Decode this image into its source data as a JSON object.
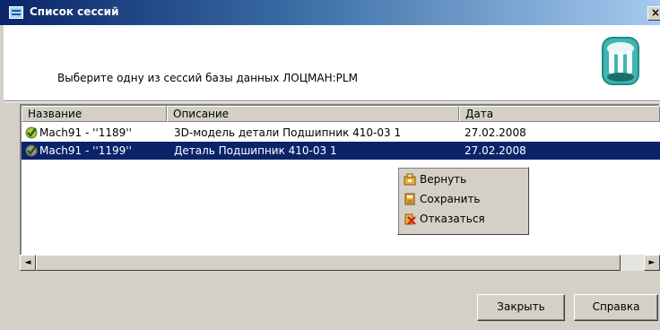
{
  "window": {
    "title": "Список сессий",
    "close_label": "×"
  },
  "header": {
    "message": "Выберите одну из сессий базы данных ЛОЦМАН:PLM",
    "icon": "database-icon"
  },
  "list": {
    "columns": [
      "Название",
      "Описание",
      "Дата"
    ],
    "rows": [
      {
        "name": "Mach91 - ''1189''",
        "description": "3D-модель детали Подшипник 410-03 1",
        "date": "27.02.2008",
        "icon": "checkmark-icon",
        "selected": false
      },
      {
        "name": "Mach91 - ''1199''",
        "description": "Деталь Подшипник 410-03 1",
        "date": "27.02.2008",
        "icon": "checkmark-icon",
        "selected": true
      }
    ]
  },
  "context_menu": {
    "items": [
      {
        "label": "Вернуть",
        "icon": "restore-icon"
      },
      {
        "label": "Сохранить",
        "icon": "save-icon"
      },
      {
        "label": "Отказаться",
        "icon": "discard-icon"
      }
    ]
  },
  "scrollbar": {
    "left_arrow": "◄",
    "right_arrow": "►"
  },
  "buttons": {
    "close": "Закрыть",
    "help": "Справка"
  },
  "colors": {
    "title_start": "#0a246a",
    "title_end": "#a6caf0",
    "selection": "#0a246a",
    "face": "#d4d0c8"
  }
}
